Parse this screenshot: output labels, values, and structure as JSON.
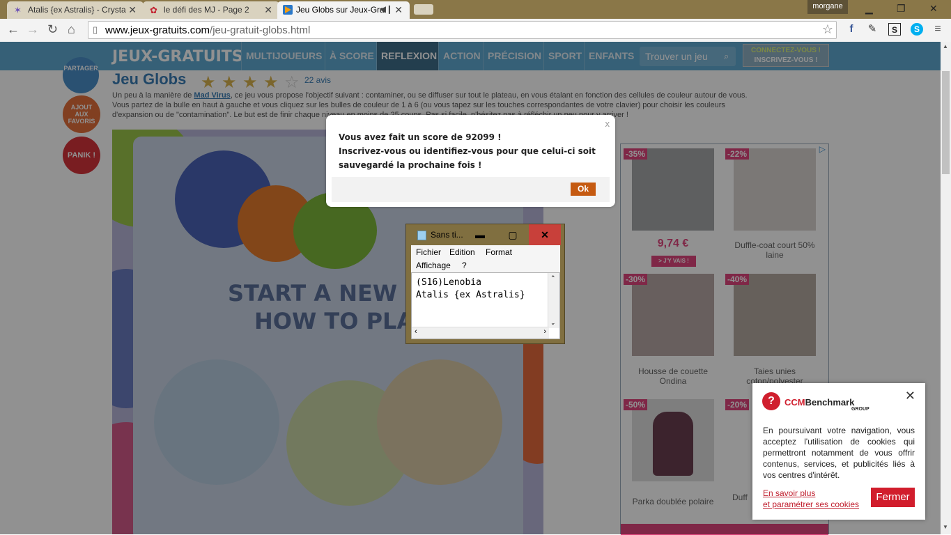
{
  "browser": {
    "tabs": [
      {
        "title": "Atalis {ex Astralis} - Crysta"
      },
      {
        "title": "le défi des MJ - Page 2"
      },
      {
        "title": "Jeu Globs sur Jeux-Gra"
      }
    ],
    "user": "morgane",
    "url_host": "www.jeux-gratuits.com",
    "url_path": "/jeu-gratuit-globs.html"
  },
  "site": {
    "logo": "JEUX-GRATUITS",
    "nav": [
      {
        "label": "MULTIJOUEURS"
      },
      {
        "label": "À SCORE"
      },
      {
        "label": "REFLEXION"
      },
      {
        "label": "ACTION"
      },
      {
        "label": "PRÉCISION"
      },
      {
        "label": "SPORT"
      },
      {
        "label": "ENFANTS"
      }
    ],
    "search_placeholder": "Trouver un jeu",
    "login_connect": "CONNECTEZ-VOUS !",
    "login_register": "INSCRIVEZ-VOUS !"
  },
  "side_buttons": {
    "share": "PARTAGER",
    "fav": "AJOUT AUX FAVORIS",
    "panik": "PANIK !"
  },
  "game": {
    "title": "Jeu Globs",
    "rating_count": "22 avis",
    "desc_line1_a": "Un peu à la manière de ",
    "desc_link": "Mad Virus",
    "desc_line1_b": ", ce jeu vous propose l'objectif suivant : contaminer, ou se diffuser sur tout le plateau, en vous étalant en fonction des cellules de couleur autour de vous.",
    "desc_line2": "Vous partez de la bulle en haut à gauche et vous cliquez sur les bulles de couleur de 1 à 6 (ou vous tapez sur les touches correspondantes de votre clavier) pour choisir les couleurs",
    "desc_line3": "d'expansion ou de \"contamination\". Le but est de finir chaque niveau en moins de 25 coups. Pas si facile, n'hésitez pas à réfléchir un peu pour y arriver !",
    "start_text": "START A NEW GA",
    "howto_text": "HOW TO PLAY"
  },
  "ads": [
    {
      "discount": "-35%",
      "price": "9,74 €",
      "cta": "> J'Y VAIS !"
    },
    {
      "discount": "-22%",
      "caption": "Duffle-coat court 50% laine"
    },
    {
      "discount": "-30%",
      "caption": "Housse de couette Ondina"
    },
    {
      "discount": "-40%",
      "caption": "Taies unies coton/polyester"
    },
    {
      "discount": "-50%",
      "caption": "Parka doublée polaire"
    },
    {
      "discount": "-20%",
      "caption": "Duff"
    }
  ],
  "score_dialog": {
    "line1": "Vous avez fait un score de 92099 !",
    "line2": "Inscrivez-vous ou identifiez-vous pour que celui-ci soit",
    "line3": "sauvegardé la prochaine fois !",
    "ok": "Ok",
    "close": "x"
  },
  "notepad": {
    "title": "Sans ti...",
    "menu": [
      "Fichier",
      "Edition",
      "Format",
      "Affichage",
      "?"
    ],
    "text": "(S16)Lenobia\nAtalis {ex Astralis}"
  },
  "cookie": {
    "brand_ccm": "CCM",
    "brand_rest": "Benchmark",
    "brand_sub": "GROUP",
    "text": "En poursuivant votre navigation, vous acceptez l'utilisation de cookies qui permettront notamment de vous offrir contenus, services, et publicités liés à vos centres d'intérêt.",
    "link1": "En savoir plus",
    "link2": "et paramétrer ses cookies",
    "button": "Fermer"
  },
  "colors": {
    "site_header": "#5fa9d1",
    "nav_selected": "#3f6d8a",
    "ok_button": "#c55a11",
    "cookie_button": "#d11d2c",
    "discount_badge": "#e0467e"
  }
}
